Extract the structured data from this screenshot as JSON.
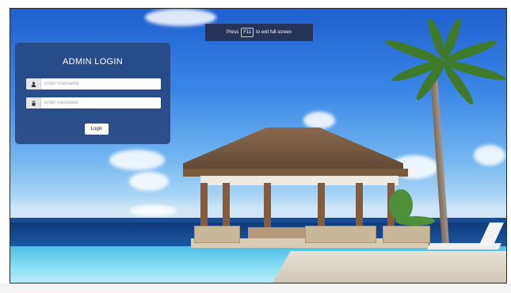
{
  "fullscreen_notice": {
    "prefix": "Press",
    "key": "F11",
    "suffix": "to exit full screen"
  },
  "login": {
    "title": "ADMIN LOGIN",
    "username_placeholder": "Enter Username",
    "password_placeholder": "Enter Password",
    "button_label": "Login"
  },
  "icons": {
    "username": "user-icon",
    "password": "lock-icon"
  },
  "colors": {
    "panel_bg": "#284882",
    "toast_bg": "#26304e",
    "field_bg": "#ffffff"
  }
}
